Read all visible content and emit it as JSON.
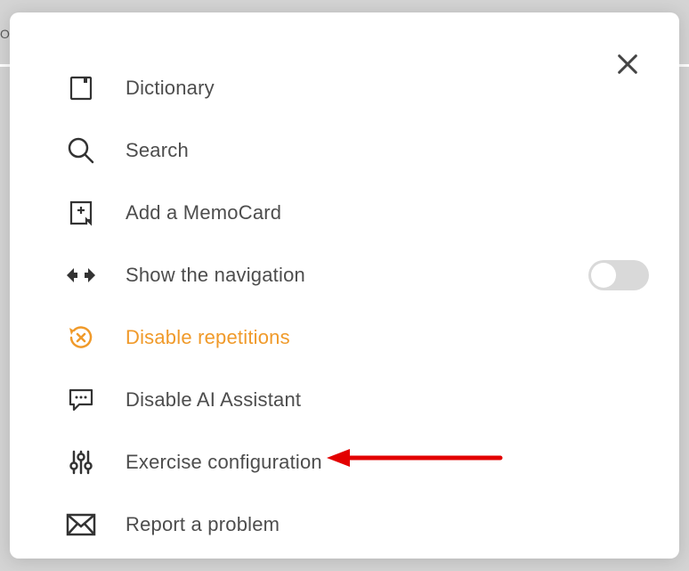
{
  "background": {
    "hint": "Or"
  },
  "menu": {
    "items": [
      {
        "label": "Dictionary",
        "icon": "dictionary-icon"
      },
      {
        "label": "Search",
        "icon": "search-icon"
      },
      {
        "label": "Add a MemoCard",
        "icon": "add-card-icon"
      },
      {
        "label": "Show the navigation",
        "icon": "nav-arrows-icon",
        "toggle": false
      },
      {
        "label": "Disable repetitions",
        "icon": "disable-repetitions-icon",
        "highlight": true
      },
      {
        "label": "Disable AI Assistant",
        "icon": "chat-icon"
      },
      {
        "label": "Exercise configuration",
        "icon": "sliders-icon"
      },
      {
        "label": "Report a problem",
        "icon": "mail-icon"
      }
    ]
  }
}
